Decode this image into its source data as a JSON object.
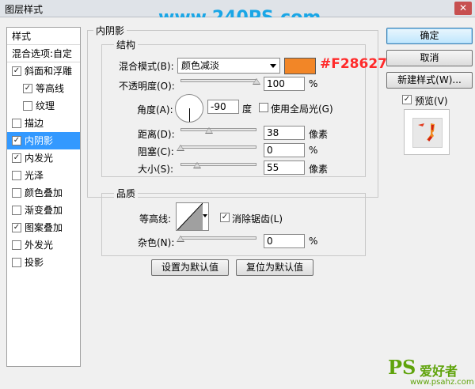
{
  "window": {
    "title": "图层样式",
    "close": "✕"
  },
  "watermark": "www.240PS.com",
  "sidebar": {
    "header": "样式",
    "blend_options": "混合选项:自定",
    "items": [
      {
        "label": "斜面和浮雕",
        "checked": true
      },
      {
        "label": "等高线",
        "checked": true,
        "indent": true
      },
      {
        "label": "纹理",
        "checked": false,
        "indent": true
      },
      {
        "label": "描边",
        "checked": false
      },
      {
        "label": "内阴影",
        "checked": true,
        "selected": true
      },
      {
        "label": "内发光",
        "checked": true
      },
      {
        "label": "光泽",
        "checked": false
      },
      {
        "label": "颜色叠加",
        "checked": false
      },
      {
        "label": "渐变叠加",
        "checked": false
      },
      {
        "label": "图案叠加",
        "checked": true
      },
      {
        "label": "外发光",
        "checked": false
      },
      {
        "label": "投影",
        "checked": false
      }
    ]
  },
  "panel": {
    "title": "内阴影",
    "structure": {
      "title": "结构",
      "blend_mode_label": "混合模式(B):",
      "blend_mode_value": "颜色减淡",
      "color_swatch": "#f28627",
      "color_hex_label": "#F28627",
      "opacity_label": "不透明度(O):",
      "opacity_value": "100",
      "opacity_unit": "%",
      "opacity_level": 1.0,
      "angle_label": "角度(A):",
      "angle_value": "-90",
      "angle_unit": "度",
      "global_light_label": "使用全局光(G)",
      "global_light_checked": false,
      "distance_label": "距离(D):",
      "distance_value": "38",
      "distance_unit": "像素",
      "distance_level": 0.38,
      "choke_label": "阻塞(C):",
      "choke_value": "0",
      "choke_unit": "%",
      "choke_level": 0.0,
      "size_label": "大小(S):",
      "size_value": "55",
      "size_unit": "像素",
      "size_level": 0.22
    },
    "quality": {
      "title": "品质",
      "contour_label": "等高线:",
      "anti_alias_label": "消除锯齿(L)",
      "anti_alias_checked": true,
      "noise_label": "杂色(N):",
      "noise_value": "0",
      "noise_unit": "%",
      "noise_level": 0.0
    },
    "set_default": "设置为默认值",
    "reset_default": "复位为默认值"
  },
  "buttons": {
    "ok": "确定",
    "cancel": "取消",
    "new_style": "新建样式(W)...",
    "preview_label": "预览(V)",
    "preview_checked": true
  },
  "logo": {
    "ps": "PS",
    "text": "爱好者",
    "url": "www.psahz.com"
  }
}
